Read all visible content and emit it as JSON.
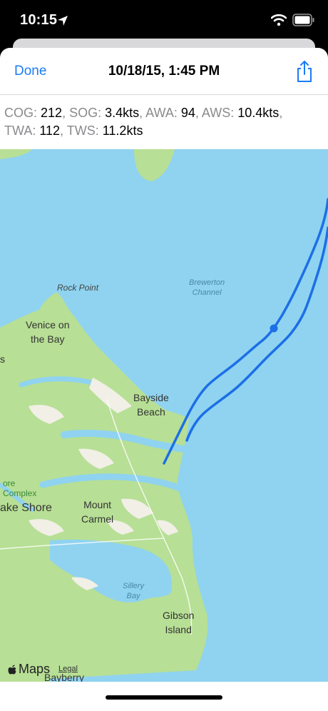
{
  "status_bar": {
    "time": "10:15"
  },
  "nav": {
    "done_label": "Done",
    "title": "10/18/15, 1:45 PM"
  },
  "stats": [
    {
      "key": "COG:",
      "value": "212"
    },
    {
      "key": "SOG:",
      "value": "3.4kts"
    },
    {
      "key": "AWA:",
      "value": "94"
    },
    {
      "key": "AWS:",
      "value": "10.4kts"
    },
    {
      "key": "TWA:",
      "value": "112"
    },
    {
      "key": "TWS:",
      "value": "11.2kts"
    }
  ],
  "map": {
    "labels": {
      "rock_point": "Rock Point",
      "venice_1": "Venice on",
      "venice_2": "the Bay",
      "bayside_1": "Bayside",
      "bayside_2": "Beach",
      "mount_1": "Mount",
      "mount_2": "Carmel",
      "gibson_1": "Gibson",
      "gibson_2": "Island",
      "lake_shore": "ake Shore",
      "complex": "Complex",
      "ore": "ore",
      "bayberry": "Bayberry",
      "s_edge": "s"
    },
    "water_labels": {
      "brewerton_1": "Brewerton",
      "brewerton_2": "Channel",
      "sillery_1": "Sillery",
      "sillery_2": "Bay"
    },
    "attribution": {
      "logo": "Maps",
      "legal": "Legal"
    },
    "colors": {
      "water": "#8fd3f0",
      "land": "#b7df95",
      "track": "#1c6fe6"
    }
  }
}
